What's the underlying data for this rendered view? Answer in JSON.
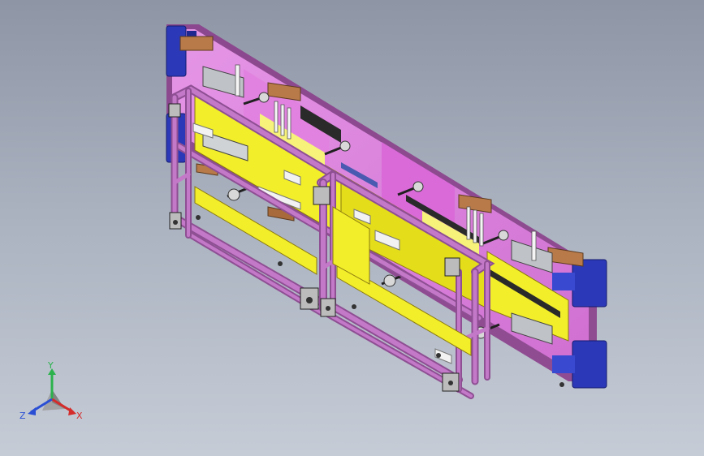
{
  "viewport": {
    "background_top": "#8e96a6",
    "background_bottom": "#c6ccd6"
  },
  "model": {
    "colors": {
      "frame_tube": "#c478c8",
      "frame_tube_dark": "#8e4f93",
      "back_plate": "#e08ae0",
      "back_plate_edge": "#8b3f8b",
      "panel_yellow": "#f2ee2a",
      "clamp_blue": "#2b39b8",
      "block_brown": "#b87a48",
      "gray_part": "#bfc3c7",
      "black_part": "#2a2a2a",
      "white_roller": "#f2f2f2"
    }
  },
  "triad": {
    "icon": "axis-triad-icon",
    "x_label": "X",
    "y_label": "Y",
    "z_label": "Z",
    "x_color": "#d42b2b",
    "y_color": "#2bb24c",
    "z_color": "#2b4fd4"
  }
}
